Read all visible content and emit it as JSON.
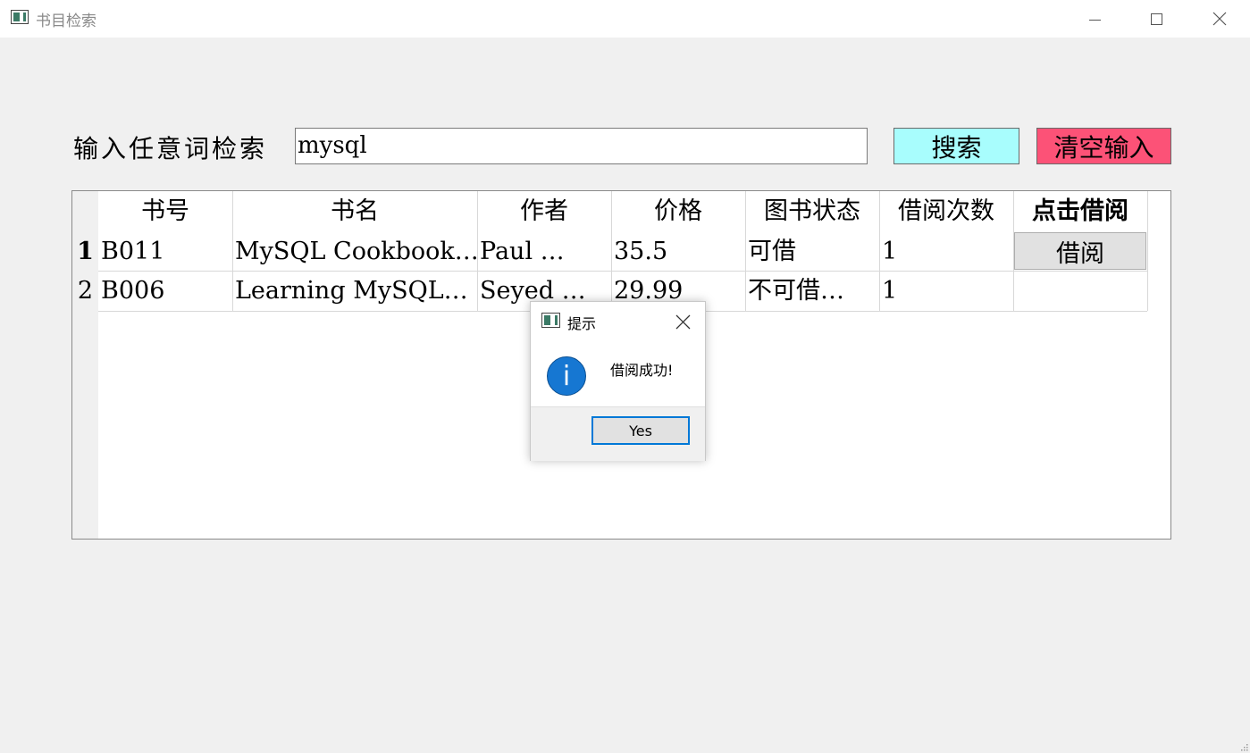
{
  "window": {
    "title": "书目检索",
    "icon": "app-window-icon"
  },
  "search": {
    "label": "输入任意词检索",
    "value": "mysql",
    "search_button": "搜索",
    "clear_button": "清空输入",
    "search_button_color": "#a8fdfd",
    "clear_button_color": "#fc5277"
  },
  "table": {
    "headers": [
      "书号",
      "书名",
      "作者",
      "价格",
      "图书状态",
      "借阅次数",
      "点击借阅"
    ],
    "rows": [
      {
        "row_number": "1",
        "cells": [
          "B011",
          "MySQL Cookbook…",
          "Paul …",
          "35.5",
          "可借",
          "1"
        ],
        "action": "借阅"
      },
      {
        "row_number": "2",
        "cells": [
          "B006",
          "Learning MySQL…",
          "Seyed …",
          "29.99",
          "不可借…",
          "1"
        ],
        "action": ""
      }
    ]
  },
  "dialog": {
    "title": "提示",
    "icon": "info-icon",
    "message": "借阅成功!",
    "yes_button": "Yes",
    "accent_color": "#0078d7"
  }
}
